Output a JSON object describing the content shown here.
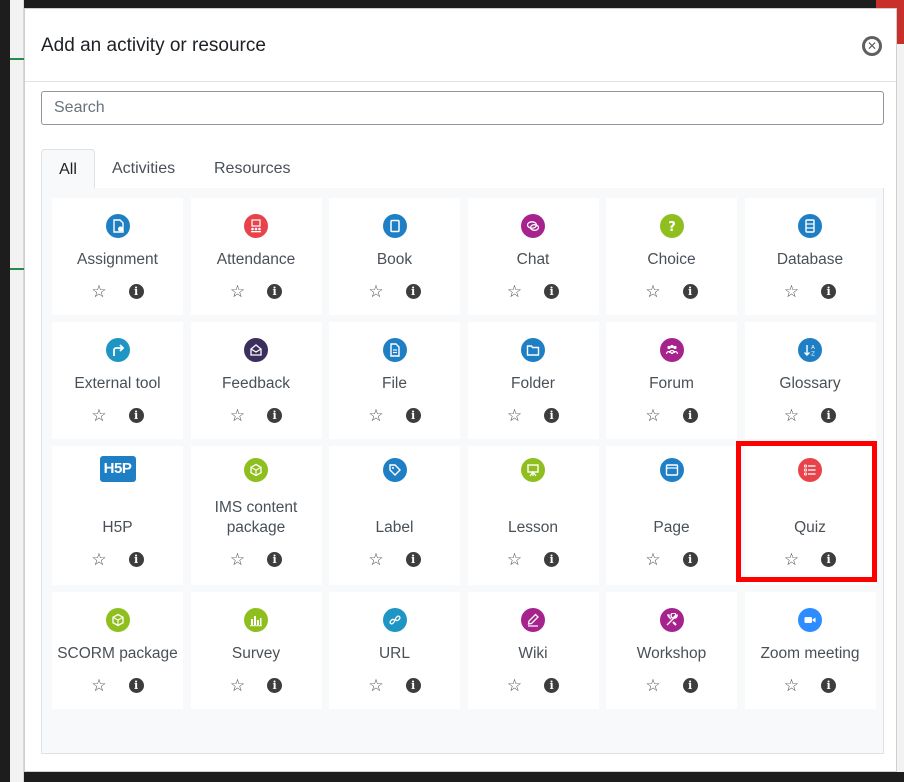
{
  "modal": {
    "title": "Add an activity or resource",
    "close_icon": "close-circle-icon"
  },
  "search": {
    "placeholder": "Search",
    "value": ""
  },
  "tabs": [
    {
      "label": "All",
      "active": true
    },
    {
      "label": "Activities",
      "active": false
    },
    {
      "label": "Resources",
      "active": false
    }
  ],
  "items": [
    {
      "label": "Assignment",
      "icon": "assignment-icon",
      "color": "#1f7fc4"
    },
    {
      "label": "Attendance",
      "icon": "attendance-icon",
      "color": "#e8434a"
    },
    {
      "label": "Book",
      "icon": "book-icon",
      "color": "#1f7fc4"
    },
    {
      "label": "Chat",
      "icon": "chat-icon",
      "color": "#a6238e"
    },
    {
      "label": "Choice",
      "icon": "choice-icon",
      "color": "#8fbf1f"
    },
    {
      "label": "Database",
      "icon": "database-icon",
      "color": "#1f7fc4"
    },
    {
      "label": "External tool",
      "icon": "external-tool-icon",
      "color": "#1f95c4"
    },
    {
      "label": "Feedback",
      "icon": "feedback-icon",
      "color": "#3b2f5e"
    },
    {
      "label": "File",
      "icon": "file-icon",
      "color": "#1f7fc4"
    },
    {
      "label": "Folder",
      "icon": "folder-icon",
      "color": "#1f7fc4"
    },
    {
      "label": "Forum",
      "icon": "forum-icon",
      "color": "#a6238e"
    },
    {
      "label": "Glossary",
      "icon": "glossary-icon",
      "color": "#1f7fc4"
    },
    {
      "label": "H5P",
      "icon": "h5p-icon",
      "color": "#1f7fc4"
    },
    {
      "label": "IMS content package",
      "icon": "ims-package-icon",
      "color": "#8fbf1f"
    },
    {
      "label": "Label",
      "icon": "label-icon",
      "color": "#1f7fc4"
    },
    {
      "label": "Lesson",
      "icon": "lesson-icon",
      "color": "#8fbf1f"
    },
    {
      "label": "Page",
      "icon": "page-icon",
      "color": "#1f7fc4"
    },
    {
      "label": "Quiz",
      "icon": "quiz-icon",
      "color": "#e8434a"
    },
    {
      "label": "SCORM package",
      "icon": "scorm-package-icon",
      "color": "#8fbf1f"
    },
    {
      "label": "Survey",
      "icon": "survey-icon",
      "color": "#8fbf1f"
    },
    {
      "label": "URL",
      "icon": "url-icon",
      "color": "#1f95c4"
    },
    {
      "label": "Wiki",
      "icon": "wiki-icon",
      "color": "#a6238e"
    },
    {
      "label": "Workshop",
      "icon": "workshop-icon",
      "color": "#a6238e"
    },
    {
      "label": "Zoom meeting",
      "icon": "zoom-meeting-icon",
      "color": "#2d8cff"
    }
  ],
  "item_actions": {
    "star_icon": "star-outline-icon",
    "info_icon": "info-icon",
    "star_glyph": "☆",
    "info_glyph": "i"
  },
  "highlighted_item": "Quiz",
  "highlight_color": "#ff0000"
}
